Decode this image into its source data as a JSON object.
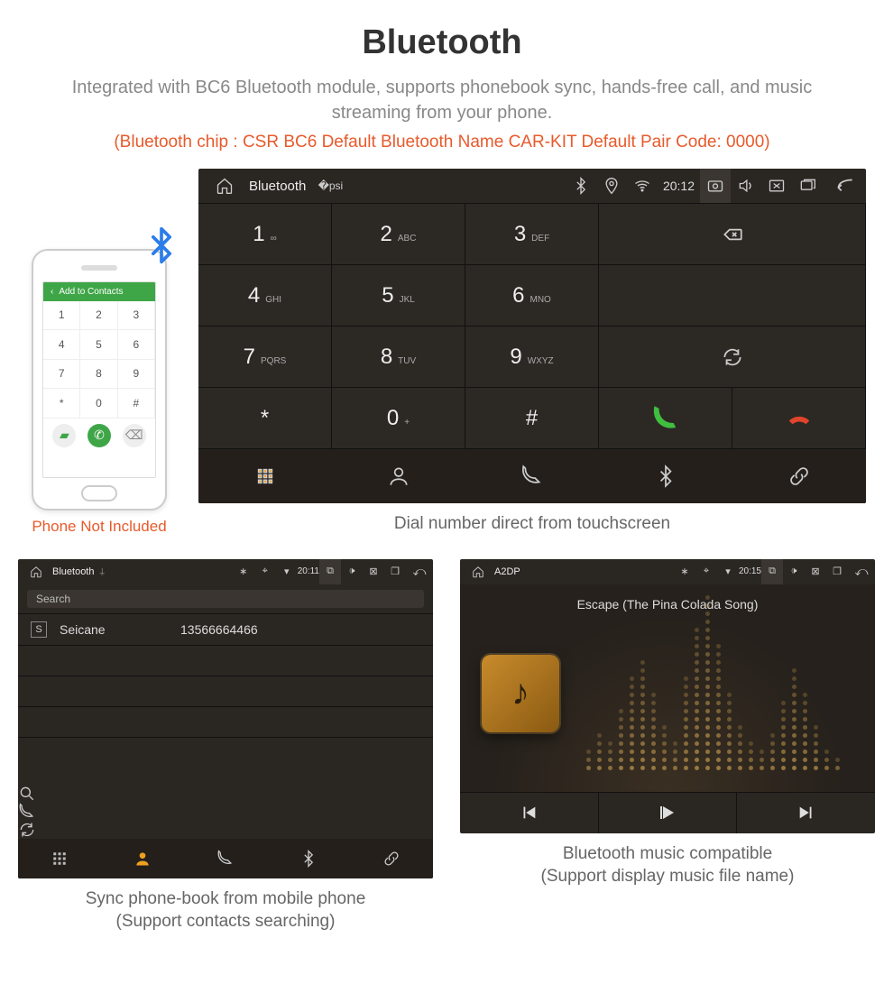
{
  "title": "Bluetooth",
  "subtitle": "Integrated with BC6 Bluetooth module, supports phonebook sync, hands-free call, and music streaming from your phone.",
  "specs": "(Bluetooth chip : CSR BC6     Default Bluetooth Name CAR-KIT     Default Pair Code: 0000)",
  "phone": {
    "add_contacts": "Add to Contacts",
    "note": "Phone Not Included",
    "keys": [
      "1",
      "2",
      "3",
      "4",
      "5",
      "6",
      "7",
      "8",
      "9",
      "*",
      "0",
      "#"
    ]
  },
  "main_device": {
    "top_title": "Bluetooth",
    "time": "20:12",
    "keys": [
      {
        "n": "1",
        "s": "∞"
      },
      {
        "n": "2",
        "s": "ABC"
      },
      {
        "n": "3",
        "s": "DEF"
      },
      {
        "n": "4",
        "s": "GHI"
      },
      {
        "n": "5",
        "s": "JKL"
      },
      {
        "n": "6",
        "s": "MNO"
      },
      {
        "n": "7",
        "s": "PQRS"
      },
      {
        "n": "8",
        "s": "TUV"
      },
      {
        "n": "9",
        "s": "WXYZ"
      },
      {
        "n": "*",
        "s": ""
      },
      {
        "n": "0",
        "s": "+"
      },
      {
        "n": "#",
        "s": ""
      }
    ],
    "caption": "Dial number direct from touchscreen"
  },
  "contacts_device": {
    "top_title": "Bluetooth",
    "time": "20:11",
    "search_placeholder": "Search",
    "contact_badge": "S",
    "contact_name": "Seicane",
    "contact_number": "13566664466",
    "caption_l1": "Sync phone-book from mobile phone",
    "caption_l2": "(Support contacts searching)"
  },
  "music_device": {
    "top_title": "A2DP",
    "time": "20:15",
    "track": "Escape (The Pina Colada Song)",
    "caption_l1": "Bluetooth music compatible",
    "caption_l2": "(Support display music file name)"
  },
  "viz_heights": [
    3,
    5,
    4,
    8,
    12,
    14,
    10,
    6,
    4,
    12,
    18,
    22,
    16,
    10,
    6,
    4,
    3,
    5,
    9,
    13,
    10,
    6,
    3,
    2
  ]
}
